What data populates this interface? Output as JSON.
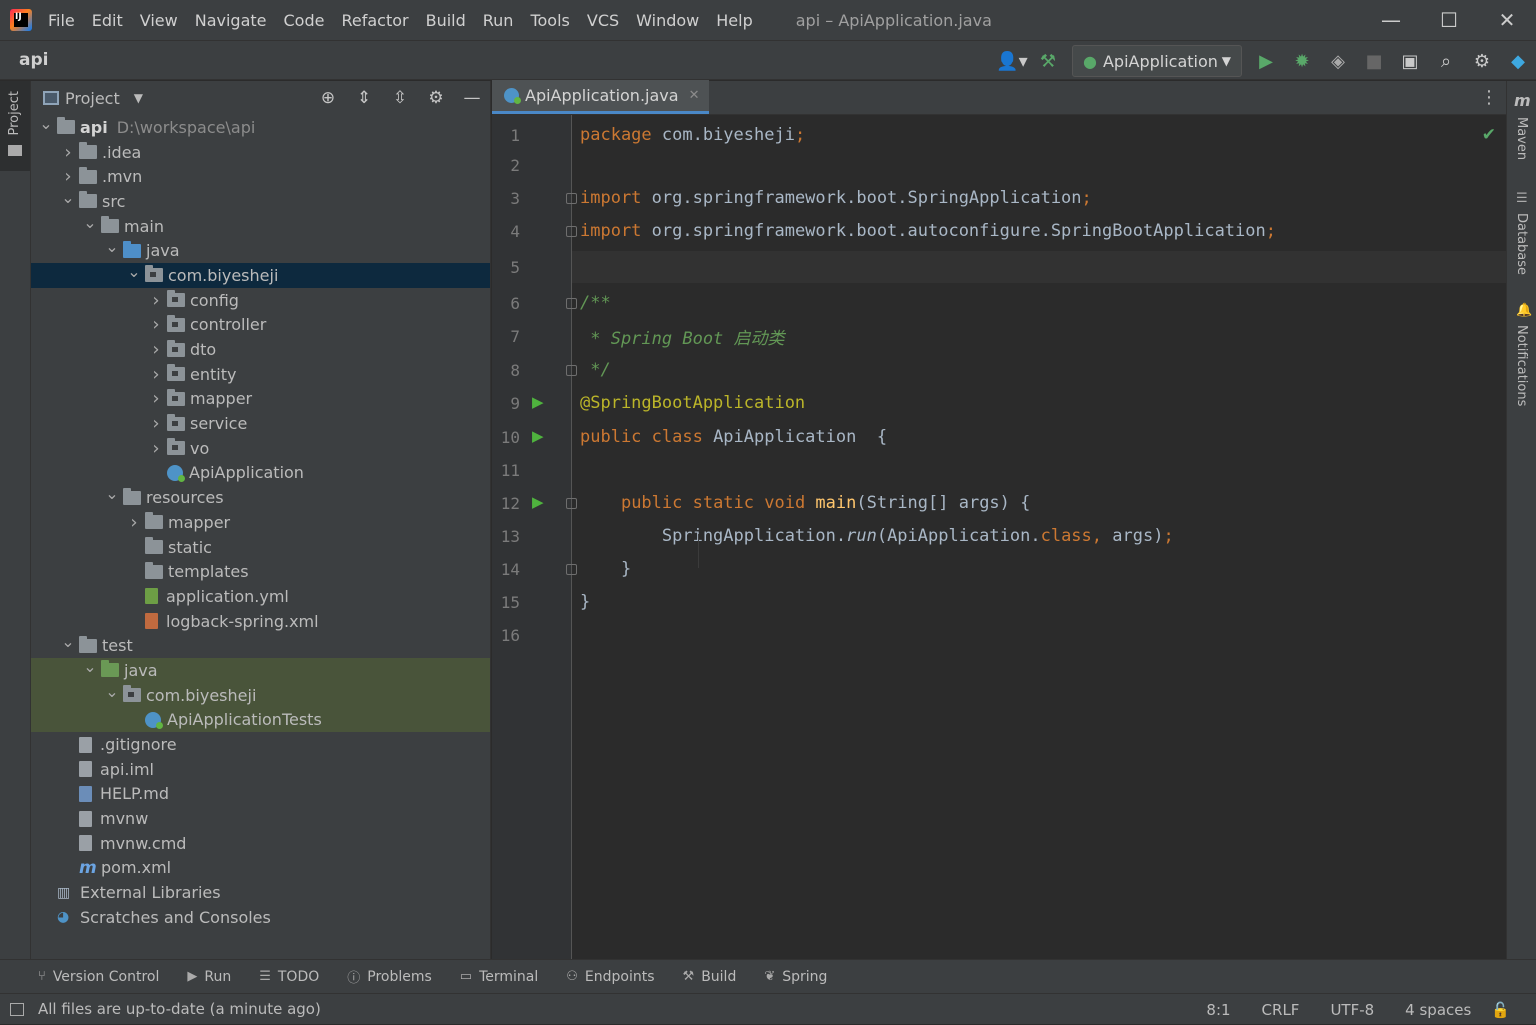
{
  "menubar": {
    "items": [
      "File",
      "Edit",
      "View",
      "Navigate",
      "Code",
      "Refactor",
      "Build",
      "Run",
      "Tools",
      "VCS",
      "Window",
      "Help"
    ],
    "title": "api – ApiApplication.java",
    "window_controls": [
      "minimize",
      "maximize",
      "close"
    ]
  },
  "navbar": {
    "project_name": "api",
    "run_config": "ApiApplication"
  },
  "project_panel": {
    "title": "Project",
    "tree": [
      {
        "label": "api",
        "path": "D:\\workspace\\api",
        "depth": 0,
        "arrow": "open",
        "icon": "folder",
        "bold": true
      },
      {
        "label": ".idea",
        "depth": 1,
        "arrow": "closed",
        "icon": "folder"
      },
      {
        "label": ".mvn",
        "depth": 1,
        "arrow": "closed",
        "icon": "folder"
      },
      {
        "label": "src",
        "depth": 1,
        "arrow": "open",
        "icon": "folder"
      },
      {
        "label": "main",
        "depth": 2,
        "arrow": "open",
        "icon": "folder"
      },
      {
        "label": "java",
        "depth": 3,
        "arrow": "open",
        "icon": "folder-src"
      },
      {
        "label": "com.biyesheji",
        "depth": 4,
        "arrow": "open",
        "icon": "package",
        "selected": true
      },
      {
        "label": "config",
        "depth": 5,
        "arrow": "closed",
        "icon": "package"
      },
      {
        "label": "controller",
        "depth": 5,
        "arrow": "closed",
        "icon": "package"
      },
      {
        "label": "dto",
        "depth": 5,
        "arrow": "closed",
        "icon": "package"
      },
      {
        "label": "entity",
        "depth": 5,
        "arrow": "closed",
        "icon": "package"
      },
      {
        "label": "mapper",
        "depth": 5,
        "arrow": "closed",
        "icon": "package"
      },
      {
        "label": "service",
        "depth": 5,
        "arrow": "closed",
        "icon": "package"
      },
      {
        "label": "vo",
        "depth": 5,
        "arrow": "closed",
        "icon": "package"
      },
      {
        "label": "ApiApplication",
        "depth": 5,
        "arrow": "none",
        "icon": "spring-class"
      },
      {
        "label": "resources",
        "depth": 3,
        "arrow": "open",
        "icon": "folder-res"
      },
      {
        "label": "mapper",
        "depth": 4,
        "arrow": "closed",
        "icon": "folder"
      },
      {
        "label": "static",
        "depth": 4,
        "arrow": "none",
        "icon": "folder"
      },
      {
        "label": "templates",
        "depth": 4,
        "arrow": "none",
        "icon": "folder"
      },
      {
        "label": "application.yml",
        "depth": 4,
        "arrow": "none",
        "icon": "yml"
      },
      {
        "label": "logback-spring.xml",
        "depth": 4,
        "arrow": "none",
        "icon": "xml"
      },
      {
        "label": "test",
        "depth": 1,
        "arrow": "open",
        "icon": "folder"
      },
      {
        "label": "java",
        "depth": 2,
        "arrow": "open",
        "icon": "folder-test",
        "test": true
      },
      {
        "label": "com.biyesheji",
        "depth": 3,
        "arrow": "open",
        "icon": "package",
        "test": true
      },
      {
        "label": "ApiApplicationTests",
        "depth": 4,
        "arrow": "none",
        "icon": "spring-class",
        "test": true
      },
      {
        "label": ".gitignore",
        "depth": 1,
        "arrow": "none",
        "icon": "file"
      },
      {
        "label": "api.iml",
        "depth": 1,
        "arrow": "none",
        "icon": "file"
      },
      {
        "label": "HELP.md",
        "depth": 1,
        "arrow": "none",
        "icon": "md"
      },
      {
        "label": "mvnw",
        "depth": 1,
        "arrow": "none",
        "icon": "file"
      },
      {
        "label": "mvnw.cmd",
        "depth": 1,
        "arrow": "none",
        "icon": "file"
      },
      {
        "label": "pom.xml",
        "depth": 1,
        "arrow": "none",
        "icon": "maven"
      },
      {
        "label": "External Libraries",
        "depth": 0,
        "arrow": "none",
        "icon": "library"
      },
      {
        "label": "Scratches and Consoles",
        "depth": 0,
        "arrow": "none",
        "icon": "scratch"
      }
    ]
  },
  "side_tools": {
    "left": "Project",
    "right": [
      "Maven",
      "Database",
      "Notifications"
    ]
  },
  "editor": {
    "tab": "ApiApplication.java",
    "lines": [
      {
        "n": "1",
        "html": [
          [
            "kw",
            "package "
          ],
          [
            "",
            "com.biyesheji"
          ],
          [
            "kw",
            ";"
          ]
        ]
      },
      {
        "n": "2",
        "html": []
      },
      {
        "n": "3",
        "html": [
          [
            "kw",
            "import "
          ],
          [
            "",
            "org.springframework.boot.SpringApplication"
          ],
          [
            "kw",
            ";"
          ]
        ],
        "fold": true
      },
      {
        "n": "4",
        "html": [
          [
            "kw",
            "import "
          ],
          [
            "",
            "org.springframework.boot.autoconfigure.SpringBootApplication"
          ],
          [
            "kw",
            ";"
          ]
        ],
        "fold": true
      },
      {
        "n": "5",
        "html": [],
        "current": true
      },
      {
        "n": "6",
        "html": [
          [
            "cmt",
            "/**"
          ]
        ],
        "fold": true
      },
      {
        "n": "7",
        "html": [
          [
            "cmt",
            " * Spring Boot 启动类"
          ]
        ]
      },
      {
        "n": "8",
        "html": [
          [
            "cmt",
            " */"
          ]
        ],
        "fold": true
      },
      {
        "n": "9",
        "html": [
          [
            "ann",
            "@SpringBootApplication"
          ]
        ],
        "run": true
      },
      {
        "n": "10",
        "html": [
          [
            "kw",
            "public class "
          ],
          [
            "",
            "ApiApplication  {"
          ]
        ],
        "run": true
      },
      {
        "n": "11",
        "html": []
      },
      {
        "n": "12",
        "html": [
          [
            "",
            "    "
          ],
          [
            "kw",
            "public static void "
          ],
          [
            "fn",
            "main"
          ],
          [
            "",
            "(String[] args) {"
          ]
        ],
        "run": true,
        "fold": true
      },
      {
        "n": "13",
        "html": [
          [
            "",
            "        SpringApplication."
          ],
          [
            "it",
            "run"
          ],
          [
            "",
            "(ApiApplication."
          ],
          [
            "kw",
            "class, "
          ],
          [
            "",
            "args)"
          ],
          [
            "kw",
            ";"
          ]
        ]
      },
      {
        "n": "14",
        "html": [
          [
            "",
            "    }"
          ]
        ],
        "fold": true
      },
      {
        "n": "15",
        "html": [
          [
            "",
            "}"
          ]
        ]
      },
      {
        "n": "16",
        "html": []
      }
    ]
  },
  "bottom_tools": [
    "Version Control",
    "Run",
    "TODO",
    "Problems",
    "Terminal",
    "Endpoints",
    "Build",
    "Spring"
  ],
  "status": {
    "message": "All files are up-to-date (a minute ago)",
    "position": "8:1",
    "line_sep": "CRLF",
    "encoding": "UTF-8",
    "indent": "4 spaces"
  },
  "colors": {
    "keyword": "#cc7832",
    "annotation": "#bbb529",
    "comment": "#629755",
    "function": "#ffc66d",
    "selection": "#0d293e",
    "test_bg": "#49543a"
  }
}
